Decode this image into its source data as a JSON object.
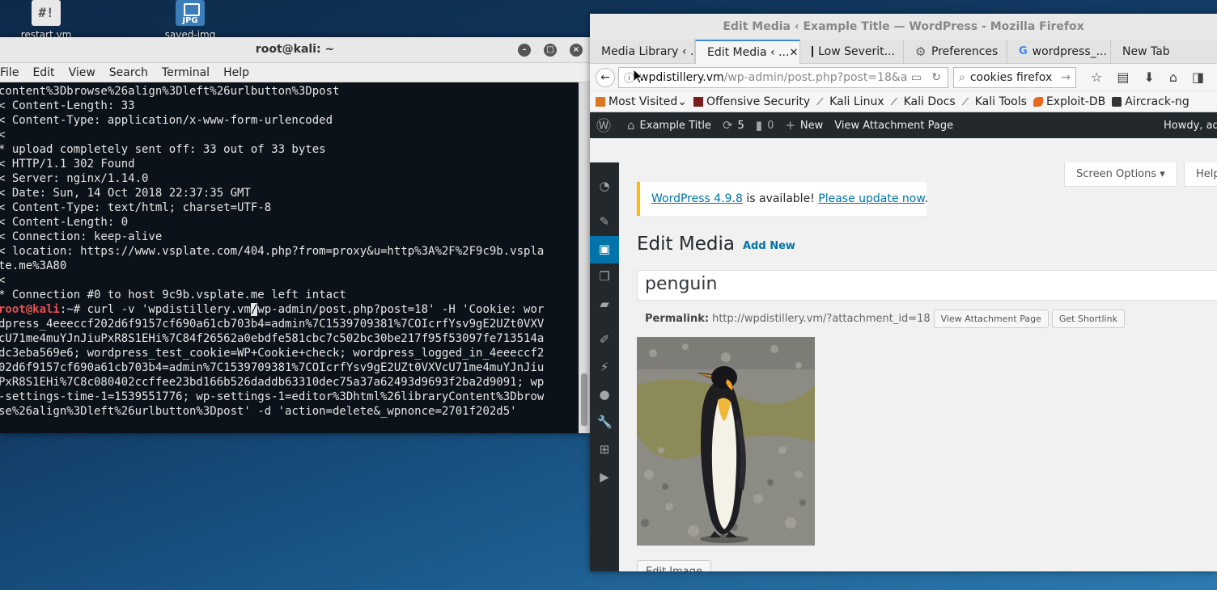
{
  "desktop": {
    "icons": [
      {
        "label": "restart.vm"
      },
      {
        "label": "saved-img",
        "badge": "JPG"
      }
    ]
  },
  "terminal": {
    "title": "root@kali: ~",
    "menu": [
      "File",
      "Edit",
      "View",
      "Search",
      "Terminal",
      "Help"
    ],
    "lines_before": [
      "content%3Dbrowse%26align%3Dleft%26urlbutton%3Dpost",
      "< Content-Length: 33",
      "< Content-Type: application/x-www-form-urlencoded",
      "<",
      "* upload completely sent off: 33 out of 33 bytes",
      "< HTTP/1.1 302 Found",
      "< Server: nginx/1.14.0",
      "< Date: Sun, 14 Oct 2018 22:37:35 GMT",
      "< Content-Type: text/html; charset=UTF-8",
      "< Content-Length: 0",
      "< Connection: keep-alive",
      "< location: https://www.vsplate.com/404.php?from=proxy&u=http%3A%2F%2F9c9b.vspla",
      "te.me%3A80",
      "<",
      "* Connection #0 to host 9c9b.vsplate.me left intact"
    ],
    "prompt": "root@kali",
    "prompt_suffix": ":~# ",
    "command_head": "curl -v 'wpdistillery.vm",
    "cursor_char": "/",
    "command_tail": "wp-admin/post.php?post=18' -H 'Cookie: wor",
    "lines_after": [
      "dpress_4eeeccf202d6f9157cf690a61cb703b4=admin%7C1539709381%7COIcrfYsv9gE2UZt0VXV",
      "cU71me4muYJnJiuPxR8S1EHi%7C84f26562a0ebdfe581cbc7c502bc30be217f95f53097fe713514a",
      "dc3eba569e6; wordpress_test_cookie=WP+Cookie+check; wordpress_logged_in_4eeeccf2",
      "02d6f9157cf690a61cb703b4=admin%7C1539709381%7COIcrfYsv9gE2UZt0VXVcU71me4muYJnJiu",
      "PxR8S1EHi%7C8c080402ccffee23bd166b526daddb63310dec75a37a62493d9693f2ba2d9091; wp",
      "-settings-time-1=1539551776; wp-settings-1=editor%3Dhtml%26libraryContent%3Dbrow",
      "se%26align%3Dleft%26urlbutton%3Dpost' -d 'action=delete&_wpnonce=2701f202d5'"
    ]
  },
  "firefox": {
    "title": "Edit Media ‹ Example Title — WordPress - Mozilla Firefox",
    "tabs": [
      {
        "label": "Media Library ‹ ..."
      },
      {
        "label": "Edit Media ‹ ..."
      },
      {
        "label": "Low Severit..."
      },
      {
        "label": "Preferences"
      },
      {
        "label": "wordpress_..."
      },
      {
        "label": "New Tab"
      }
    ],
    "url_domain": "wpdistillery.vm",
    "url_path": "/wp-admin/post.php?post=18&a",
    "search_value": "cookies firefox",
    "bookmarks": [
      "Most Visited",
      "Offensive Security",
      "Kali Linux",
      "Kali Docs",
      "Kali Tools",
      "Exploit-DB",
      "Aircrack-ng"
    ],
    "adminbar": {
      "site": "Example Title",
      "updates": "5",
      "comments": "0",
      "new": "New",
      "view": "View Attachment Page",
      "howdy": "Howdy, ad"
    }
  },
  "wp": {
    "screen_options": "Screen Options",
    "help": "Help",
    "nag_link": "WordPress 4.9.8",
    "nag_text": " is available! ",
    "nag_update": "Please update now",
    "nag_end": ".",
    "page_title": "Edit Media",
    "add_new": "Add New",
    "media_title": "penguin",
    "permalink_label": "Permalink:",
    "permalink_url": "http://wpdistillery.vm/?attachment_id=18",
    "view_attachment_btn": "View Attachment Page",
    "shortlink_btn": "Get Shortlink",
    "edit_image_btn": "Edit Image"
  }
}
